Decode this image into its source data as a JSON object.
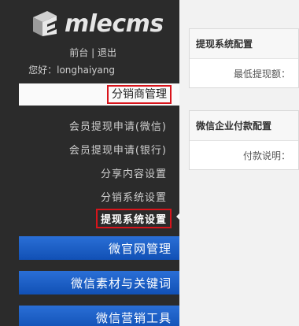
{
  "brand": {
    "name": "mlecms"
  },
  "header": {
    "front_link": "前台",
    "separator": "|",
    "logout_link": "退出",
    "greeting": "您好：longhaiyang"
  },
  "sidebar": {
    "active_group": "分销商管理",
    "sub_items": [
      "会员提现申请(微信)",
      "会员提现申请(银行)",
      "分享内容设置",
      "分销系统设置",
      "提现系统设置"
    ],
    "menu_groups": [
      "微官网管理",
      "微信素材与关键词",
      "微信营销工具"
    ]
  },
  "main": {
    "panels": [
      {
        "title": "提现系统配置",
        "field_label": "最低提现额："
      },
      {
        "title": "微信企业付款配置",
        "field_label": "付款说明："
      }
    ]
  },
  "colors": {
    "sidebar_bg": "#2b2b2b",
    "menu_blue": "#1a5fc8",
    "highlight_red": "#d8141b"
  }
}
